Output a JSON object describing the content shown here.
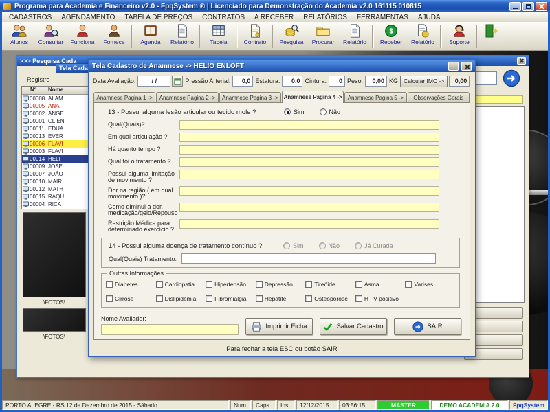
{
  "app": {
    "title": "Programa para Academia e Financeiro v2.0 - FpqSystem ® | Licenciado para  Demonstração do Academia v2.0 161115 010815",
    "menus": [
      "CADASTROS",
      "AGENDAMENTO",
      "TABELA DE PREÇOS",
      "CONTRATOS",
      "A RECEBER",
      "RELATÓRIOS",
      "FERRAMENTAS",
      "AJUDA"
    ],
    "toolbar": [
      {
        "label": "Alunos"
      },
      {
        "label": "Consultar"
      },
      {
        "label": "Funciona"
      },
      {
        "label": "Fornece"
      },
      {
        "label": "Agenda"
      },
      {
        "label": "Relatório"
      },
      {
        "label": "Tabela"
      },
      {
        "label": "Contrato"
      },
      {
        "label": "Pesquisa"
      },
      {
        "label": "Procurar"
      },
      {
        "label": "Relatório"
      },
      {
        "label": "Receber"
      },
      {
        "label": "Relatório"
      },
      {
        "label": "Suporte"
      }
    ]
  },
  "search_window": {
    "title": ">>> Pesquisa Cada",
    "child_title": "Tela Cada",
    "registro_label": "Registro",
    "columns": {
      "num": "Nº",
      "name": "Nome"
    },
    "rows": [
      {
        "num": "00008",
        "name": "ALAM"
      },
      {
        "num": "00005",
        "name": "ANAI"
      },
      {
        "num": "00002",
        "name": "ANGE"
      },
      {
        "num": "00001",
        "name": "CLIEN"
      },
      {
        "num": "00011",
        "name": "EDUA"
      },
      {
        "num": "00013",
        "name": "EVER"
      },
      {
        "num": "00006",
        "name": "FLAVI"
      },
      {
        "num": "00003",
        "name": "FLAVI"
      },
      {
        "num": "00014",
        "name": "HELI"
      },
      {
        "num": "00009",
        "name": "JOSE"
      },
      {
        "num": "00007",
        "name": "JOÃO"
      },
      {
        "num": "00010",
        "name": "MAIR"
      },
      {
        "num": "00012",
        "name": "MATH"
      },
      {
        "num": "00015",
        "name": "RAQU"
      },
      {
        "num": "00004",
        "name": "RICA"
      }
    ],
    "fotos_label_1": "\\FOTOS\\",
    "fotos_label_2": "\\FOTOS\\"
  },
  "dialog": {
    "title": "Tela Cadastro de Anamnese -> HELIO ENLOFT",
    "header": {
      "data_label": "Data Avaliação:",
      "data_value": "/ /",
      "pressao_label": "Pressão Arterial:",
      "pressao_value": "0,0",
      "estatura_label": "Estatura:",
      "estatura_value": "0,0",
      "cintura_label": "Cintura:",
      "cintura_value": "0",
      "peso_label": "Peso:",
      "peso_value": "0,00",
      "kg_label": "KG",
      "imc_button": "Calcular IMC ->",
      "imc_value": "0,00"
    },
    "tabs": [
      {
        "label": "Anamnese Pagina 1 ->"
      },
      {
        "label": "Anamnese Pagina 2 ->"
      },
      {
        "label": "Anamnese Pagina 3 ->"
      },
      {
        "label": "Anamnese Pagina 4 ->"
      },
      {
        "label": "Anamnese Pagina 5 ->"
      },
      {
        "label": "Observações Gerais"
      }
    ],
    "q13": {
      "label": "13 - Possui alguma lesão articular ou tecido mole ?",
      "opt_sim": "Sim",
      "opt_nao": "Não"
    },
    "fields": [
      {
        "label": "Qual(Quais)?"
      },
      {
        "label": "Em qual articulação ?"
      },
      {
        "label": "Há quanto tempo ?"
      },
      {
        "label": "Qual foi o tratamento ?"
      },
      {
        "label": "Possui alguma limitação de movimento ?"
      },
      {
        "label": "Dor na região ( em qual movimento )?"
      },
      {
        "label": "Como diminui a dor, medicação/gelo/Repouso"
      },
      {
        "label": "Restrição Médica para determinado exercício ?"
      }
    ],
    "q14": {
      "label": "14 - Possui alguma doença de tratamento contínuo ?",
      "opt_sim": "Sim",
      "opt_nao": "Não",
      "opt_curada": "Já Curada",
      "tratamento_label": "Qual(Quais) Tratamento:"
    },
    "outras": {
      "title": "Outras Informações",
      "row1": [
        "Diabetes",
        "Cardiopatia",
        "Hipertensão",
        "Depressão",
        "Tireóide",
        "Asma",
        "Varises"
      ],
      "row2": [
        "Cirrose",
        "Dislipidemia",
        "Fibromialgia",
        "Hepatite",
        "Osteoporose",
        "H I V positivo"
      ]
    },
    "footer": {
      "avaliador_label": "Nome Avaliador:",
      "imprimir_button": "Imprimir Ficha",
      "salvar_button": "Salvar Cadastro",
      "sair_button": "SAIR",
      "esc_note": "Para fechar a tela ESC ou botão SAIR"
    }
  },
  "statusbar": {
    "location": "PORTO ALEGRE - RS 12 de Dezembro de 2015 - Sábado",
    "num": "Num",
    "caps": "Caps",
    "ins": "Ins",
    "date": "12/12/2015",
    "time": "03:56:15",
    "user": "MASTER",
    "client": "DEMO ACADEMIA 2.0",
    "brand": "FpqSystem"
  }
}
